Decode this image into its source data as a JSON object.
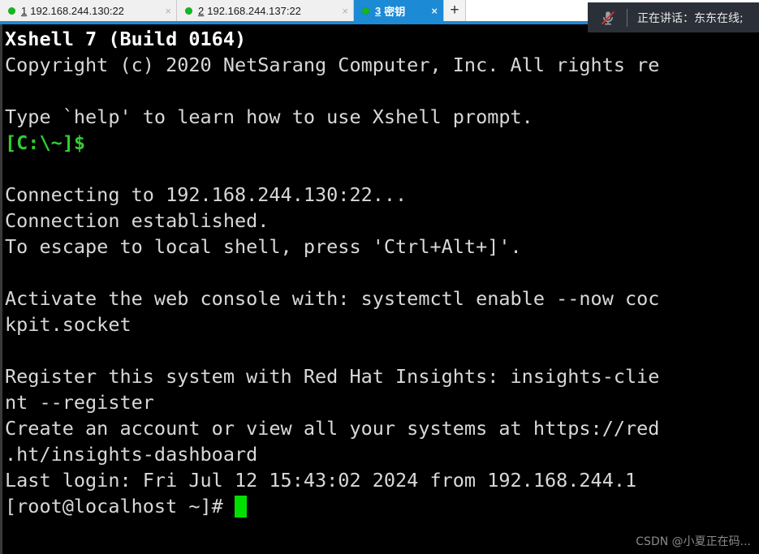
{
  "tabbar": {
    "tabs": [
      {
        "number": "1",
        "label": "192.168.244.130:22",
        "close": "×",
        "status_icon": "connected-dot-icon",
        "active": false
      },
      {
        "number": "2",
        "label": "192.168.244.137:22",
        "close": "×",
        "status_icon": "connected-dot-icon",
        "active": false
      },
      {
        "number": "3",
        "label": "密钥",
        "close": "×",
        "status_icon": "connected-dot-icon",
        "active": true
      }
    ],
    "new_tab_label": "+",
    "active_tab_color": "#1c8ad4",
    "status_dot_color": "#12b81e"
  },
  "terminal": {
    "background": "#000000",
    "foreground": "#d8d8d8",
    "prompt_color": "#33cc33",
    "cursor_color": "#00e000",
    "lines": [
      {
        "text": "Xshell 7 (Build 0164)",
        "style": "bold-white"
      },
      {
        "text": "Copyright (c) 2020 NetSarang Computer, Inc. All rights re",
        "style": "white"
      },
      {
        "text": "",
        "style": "white"
      },
      {
        "text": "Type `help' to learn how to use Xshell prompt.",
        "style": "white"
      },
      {
        "text": "[C:\\~]$",
        "style": "green"
      },
      {
        "text": "",
        "style": "white"
      },
      {
        "text": "Connecting to 192.168.244.130:22...",
        "style": "white"
      },
      {
        "text": "Connection established.",
        "style": "white"
      },
      {
        "text": "To escape to local shell, press 'Ctrl+Alt+]'.",
        "style": "white"
      },
      {
        "text": "",
        "style": "white"
      },
      {
        "text": "Activate the web console with: systemctl enable --now coc",
        "style": "white"
      },
      {
        "text": "kpit.socket",
        "style": "white"
      },
      {
        "text": "",
        "style": "white"
      },
      {
        "text": "Register this system with Red Hat Insights: insights-clie",
        "style": "white"
      },
      {
        "text": "nt --register",
        "style": "white"
      },
      {
        "text": "Create an account or view all your systems at https://red",
        "style": "white"
      },
      {
        "text": ".ht/insights-dashboard",
        "style": "white"
      },
      {
        "text": "Last login: Fri Jul 12 15:43:02 2024 from 192.168.244.1",
        "style": "white"
      }
    ],
    "prompt_line": "[root@localhost ~]# "
  },
  "voice_overlay": {
    "mic_icon": "microphone-muted-icon",
    "text": "正在讲话：东东在线;",
    "background": "#2b3038",
    "slash_color": "#d0312d"
  },
  "watermark": {
    "text": "CSDN @小夏正在码..."
  }
}
